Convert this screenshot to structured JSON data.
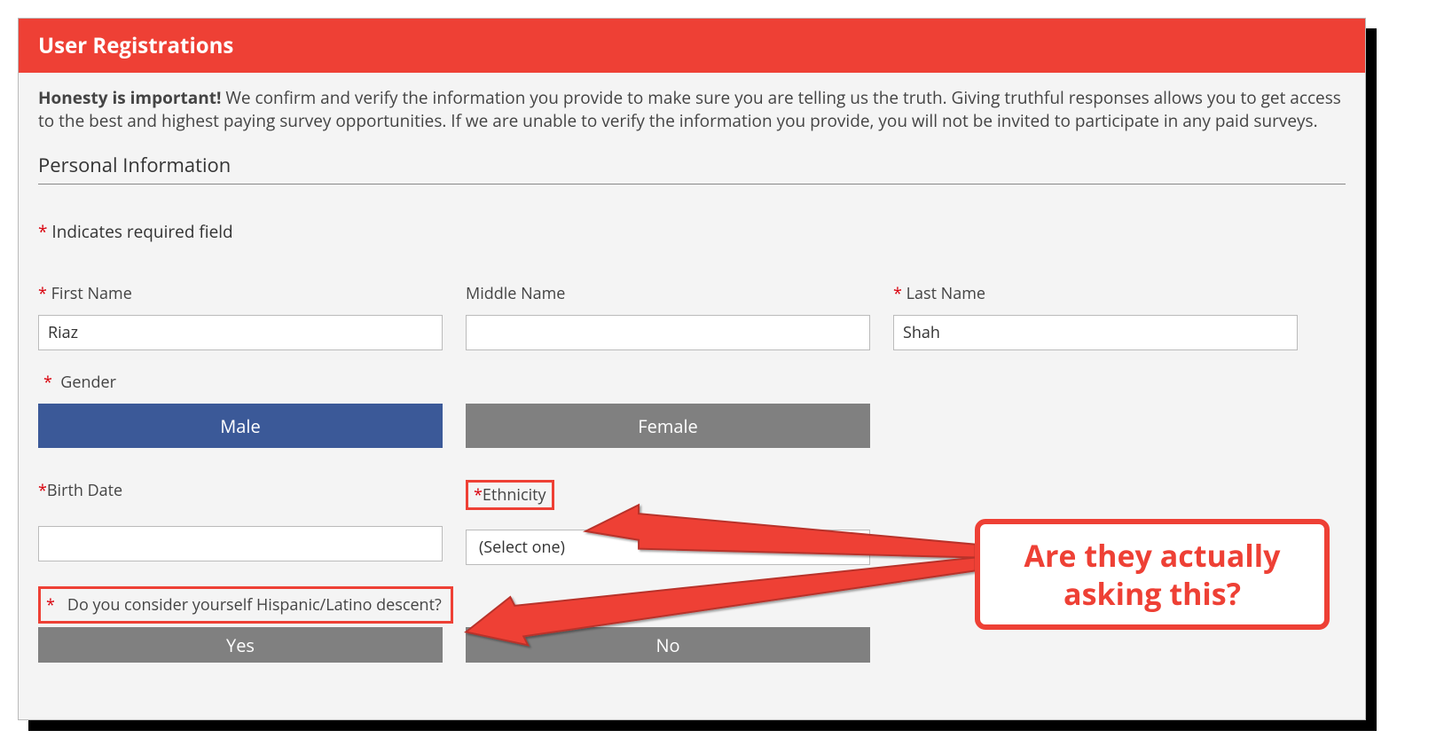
{
  "header": {
    "title": "User Registrations"
  },
  "intro": {
    "bold": "Honesty is important!",
    "rest": " We confirm and verify the information you provide to make sure you are telling us the truth. Giving truthful responses allows you to get access to the best and highest paying survey opportunities. If we are unable to verify the information you provide, you will not be invited to participate in any paid surveys."
  },
  "section": {
    "title": "Personal Information"
  },
  "required_note": {
    "star": "*",
    "text": " Indicates required field"
  },
  "fields": {
    "first_name": {
      "label": "First Name",
      "value": "Riaz",
      "required": true
    },
    "middle_name": {
      "label": "Middle Name",
      "value": "",
      "required": false
    },
    "last_name": {
      "label": "Last Name",
      "value": "Shah",
      "required": true
    },
    "gender": {
      "label": "Gender",
      "required": true,
      "options": {
        "male": "Male",
        "female": "Female"
      },
      "selected": "male"
    },
    "birth_date": {
      "label": "Birth Date",
      "value": "",
      "required": true
    },
    "ethnicity": {
      "label": "Ethnicity",
      "required": true,
      "selected_text": "(Select one)"
    },
    "hispanic": {
      "label": "Do you consider yourself Hispanic/Latino descent?",
      "required": true,
      "options": {
        "yes": "Yes",
        "no": "No"
      }
    }
  },
  "callout": {
    "text": "Are they actually asking this?"
  }
}
